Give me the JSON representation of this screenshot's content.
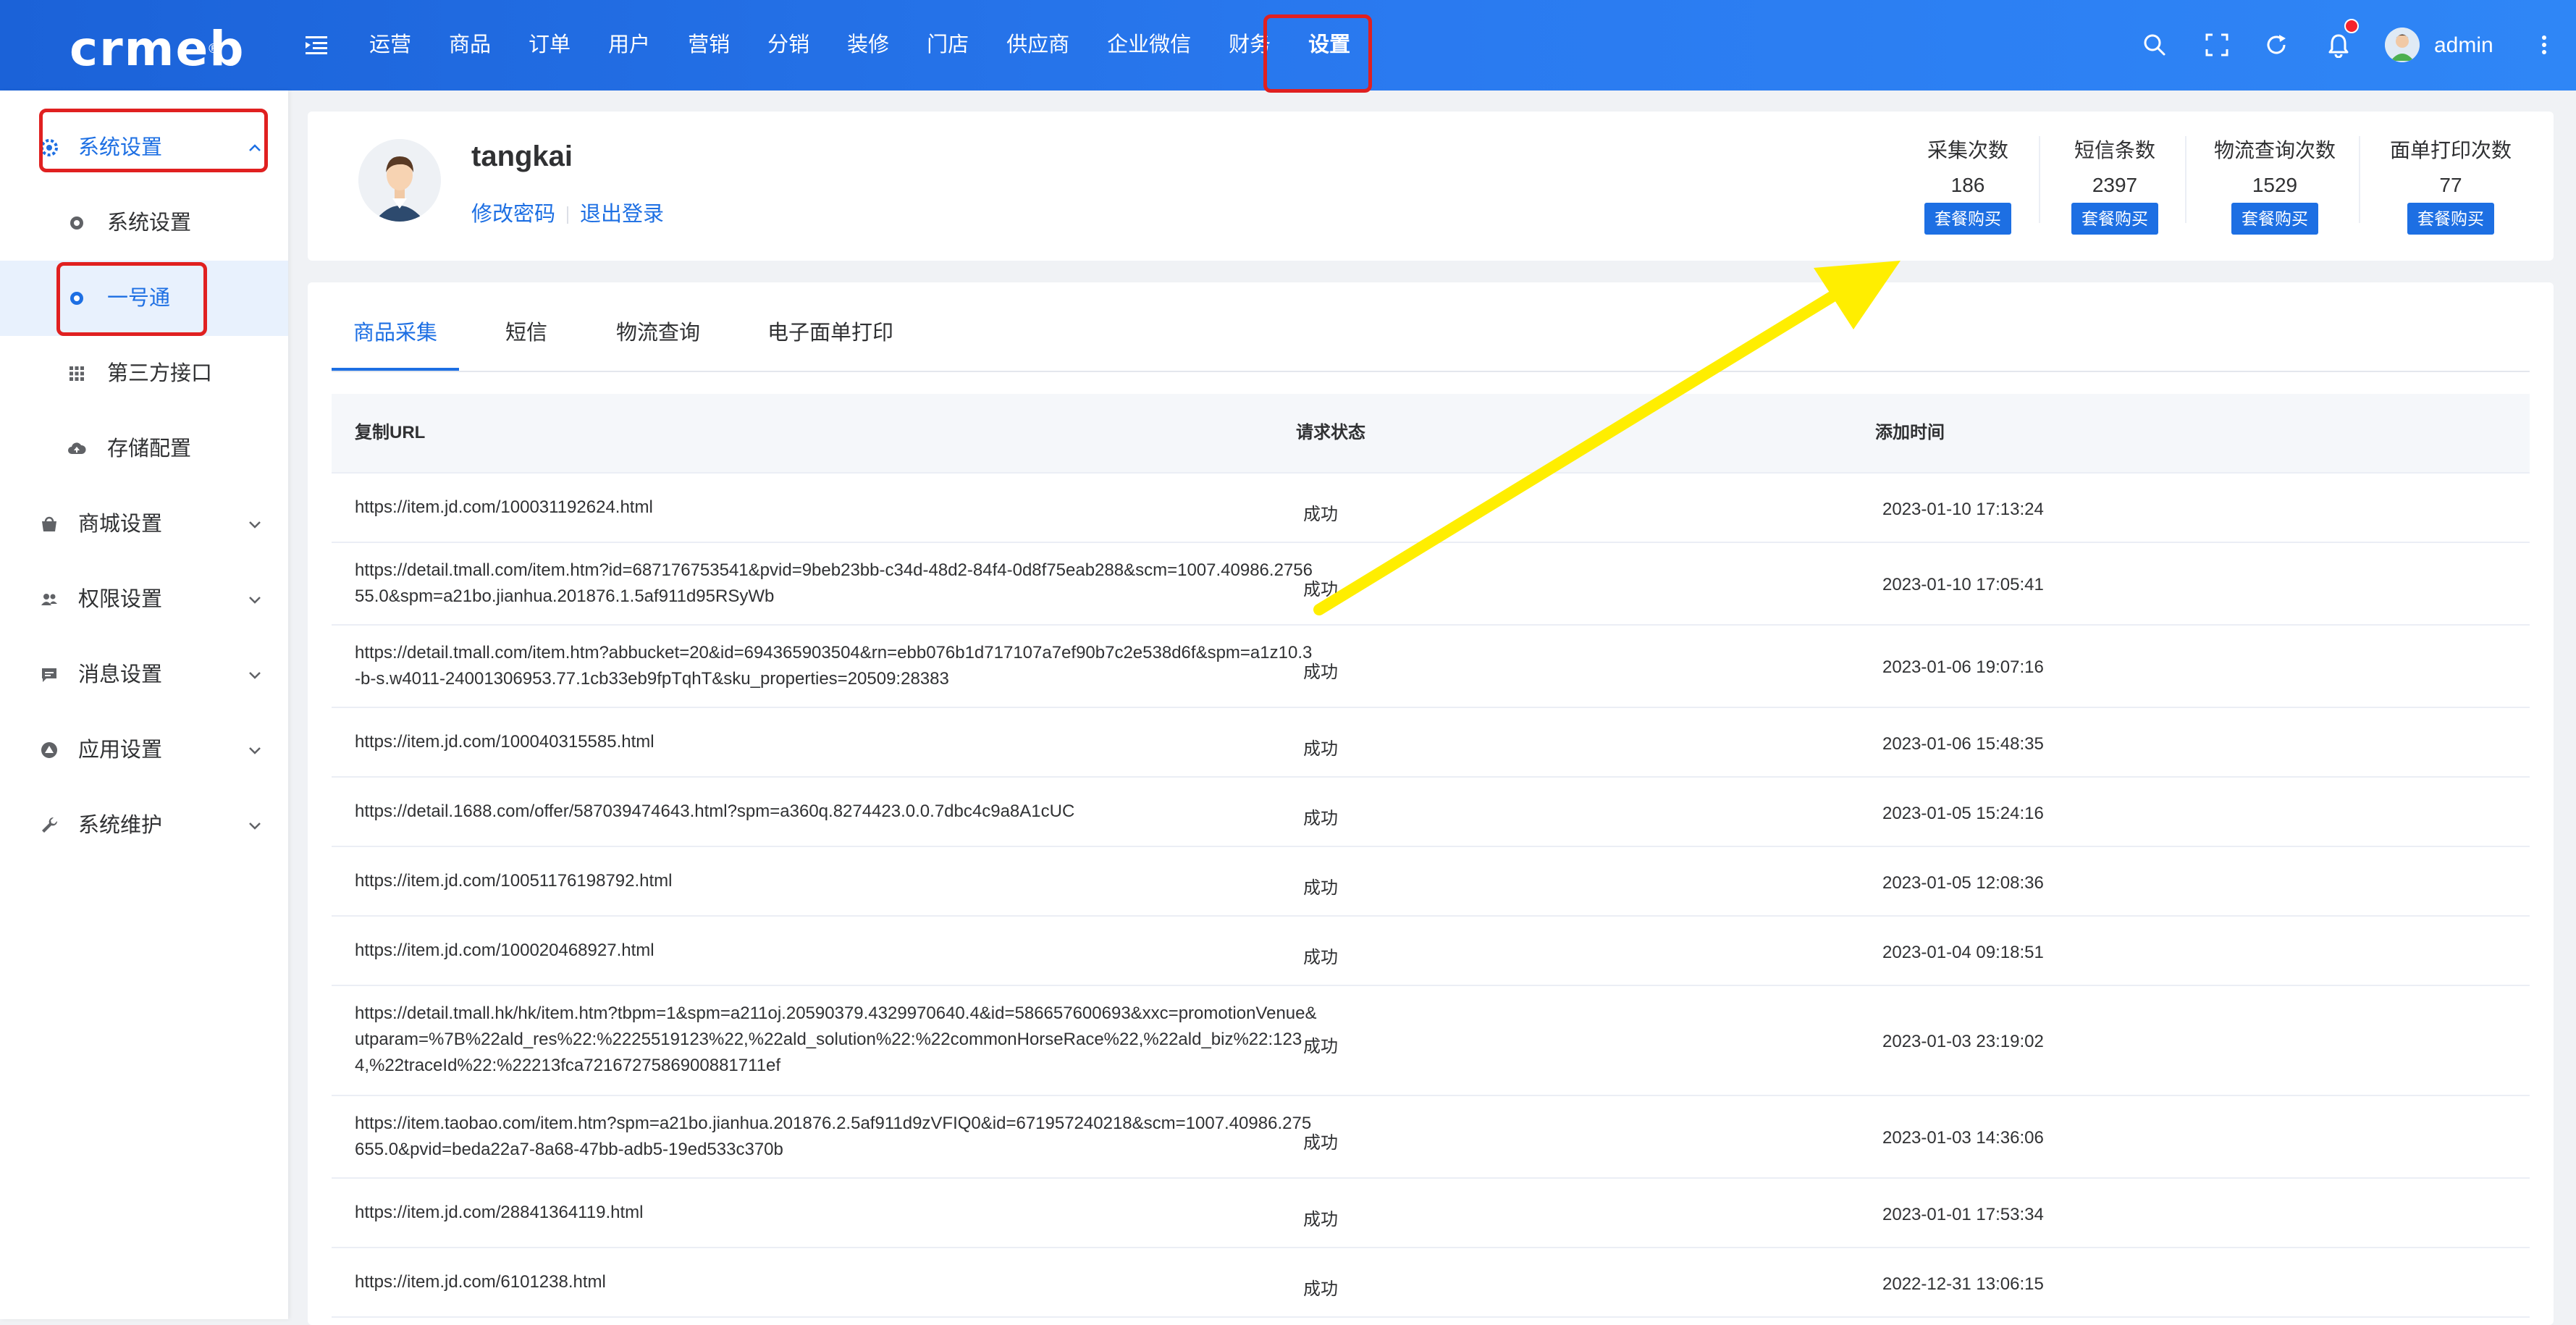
{
  "header": {
    "logo_text": "crmeb",
    "logo_mark": "®",
    "nav": [
      {
        "label": "运营"
      },
      {
        "label": "商品"
      },
      {
        "label": "订单"
      },
      {
        "label": "用户"
      },
      {
        "label": "营销"
      },
      {
        "label": "分销"
      },
      {
        "label": "装修"
      },
      {
        "label": "门店"
      },
      {
        "label": "供应商"
      },
      {
        "label": "企业微信"
      },
      {
        "label": "财务"
      },
      {
        "label": "设置",
        "active": true
      }
    ],
    "username": "admin",
    "icons": [
      "menu-fold-icon",
      "search-icon",
      "fullscreen-icon",
      "refresh-icon",
      "bell-icon",
      "more-icon"
    ]
  },
  "sidebar": {
    "items": [
      {
        "label": "系统设置",
        "icon": "gear-icon",
        "state": "open"
      },
      {
        "label": "系统设置",
        "icon": "dot-icon",
        "level": 2
      },
      {
        "label": "一号通",
        "icon": "dot-icon",
        "level": 2,
        "state": "active"
      },
      {
        "label": "第三方接口",
        "icon": "grid-icon",
        "level": 2
      },
      {
        "label": "存储配置",
        "icon": "cloud-upload-icon",
        "level": 2
      },
      {
        "label": "商城设置",
        "icon": "shop-icon"
      },
      {
        "label": "权限设置",
        "icon": "users-icon"
      },
      {
        "label": "消息设置",
        "icon": "message-icon"
      },
      {
        "label": "应用设置",
        "icon": "app-icon"
      },
      {
        "label": "系统维护",
        "icon": "wrench-icon"
      }
    ]
  },
  "profile": {
    "name": "tangkai",
    "change_password": "修改密码",
    "logout": "退出登录",
    "stats": [
      {
        "label": "采集次数",
        "value": "186",
        "button": "套餐购买"
      },
      {
        "label": "短信条数",
        "value": "2397",
        "button": "套餐购买"
      },
      {
        "label": "物流查询次数",
        "value": "1529",
        "button": "套餐购买"
      },
      {
        "label": "面单打印次数",
        "value": "77",
        "button": "套餐购买"
      }
    ]
  },
  "tabs": [
    {
      "label": "商品采集",
      "active": true
    },
    {
      "label": "短信"
    },
    {
      "label": "物流查询"
    },
    {
      "label": "电子面单打印"
    }
  ],
  "table": {
    "columns": [
      "复制URL",
      "请求状态",
      "添加时间"
    ],
    "rows": [
      {
        "url": "https://item.jd.com/100031192624.html",
        "status": "成功",
        "time": "2023-01-10 17:13:24"
      },
      {
        "url": "https://detail.tmall.com/item.htm?id=687176753541&pvid=9beb23bb-c34d-48d2-84f4-0d8f75eab288&scm=1007.40986.275655.0&spm=a21bo.jianhua.201876.1.5af911d95RSyWb",
        "status": "成功",
        "time": "2023-01-10 17:05:41"
      },
      {
        "url": "https://detail.tmall.com/item.htm?abbucket=20&id=694365903504&rn=ebb076b1d717107a7ef90b7c2e538d6f&spm=a1z10.3-b-s.w4011-24001306953.77.1cb33eb9fpTqhT&sku_properties=20509:28383",
        "status": "成功",
        "time": "2023-01-06 19:07:16"
      },
      {
        "url": "https://item.jd.com/100040315585.html",
        "status": "成功",
        "time": "2023-01-06 15:48:35"
      },
      {
        "url": "https://detail.1688.com/offer/587039474643.html?spm=a360q.8274423.0.0.7dbc4c9a8A1cUC",
        "status": "成功",
        "time": "2023-01-05 15:24:16"
      },
      {
        "url": "https://item.jd.com/10051176198792.html",
        "status": "成功",
        "time": "2023-01-05 12:08:36"
      },
      {
        "url": "https://item.jd.com/100020468927.html",
        "status": "成功",
        "time": "2023-01-04 09:18:51"
      },
      {
        "url": "https://detail.tmall.hk/hk/item.htm?tbpm=1&spm=a211oj.20590379.4329970640.4&id=586657600693&xxc=promotionVenue&utparam=%7B%22ald_res%22:%2225519123%22,%22ald_solution%22:%22commonHorseRace%22,%22ald_biz%22:1234,%22traceId%22:%22213fca7216727586900881711ef",
        "status": "成功",
        "time": "2023-01-03 23:19:02"
      },
      {
        "url": "https://item.taobao.com/item.htm?spm=a21bo.jianhua.201876.2.5af911d9zVFIQ0&id=671957240218&scm=1007.40986.275655.0&pvid=beda22a7-8a68-47bb-adb5-19ed533c370b",
        "status": "成功",
        "time": "2023-01-03 14:36:06"
      },
      {
        "url": "https://item.jd.com/28841364119.html",
        "status": "成功",
        "time": "2023-01-01 17:53:34"
      },
      {
        "url": "https://item.jd.com/6101238.html",
        "status": "成功",
        "time": "2022-12-31 13:06:15"
      }
    ]
  },
  "colors": {
    "primary": "#1d6fe3",
    "highlight_box": "#e02020",
    "arrow": "#ffee00"
  }
}
